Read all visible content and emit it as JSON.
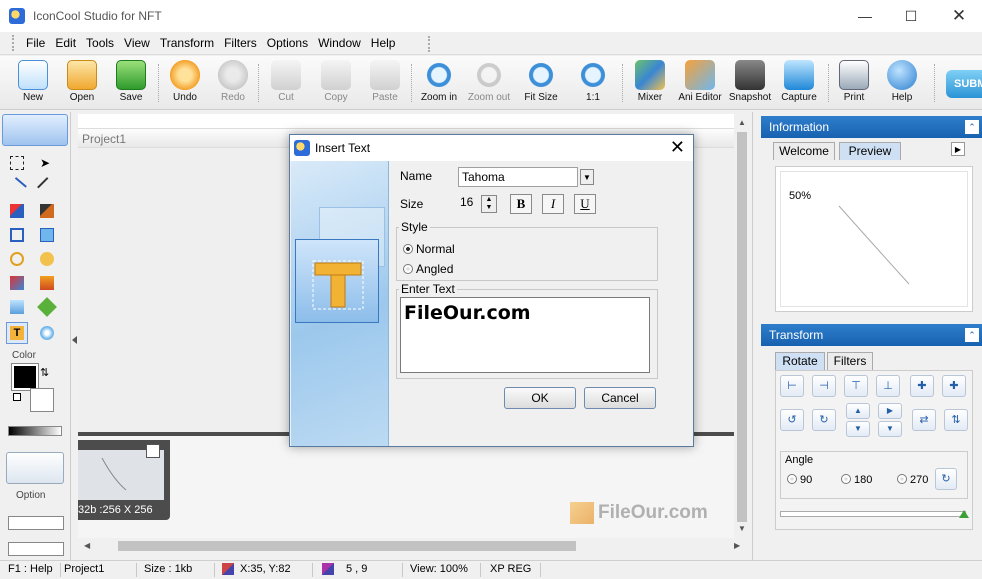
{
  "window": {
    "title": "IconCool Studio for NFT"
  },
  "menu": [
    "File",
    "Edit",
    "Tools",
    "View",
    "Transform",
    "Filters",
    "Options",
    "Window",
    "Help"
  ],
  "toolbar": [
    {
      "label": "New",
      "icon": "new-document-icon",
      "enabled": true
    },
    {
      "label": "Open",
      "icon": "open-folder-icon",
      "enabled": true
    },
    {
      "label": "Save",
      "icon": "save-disk-icon",
      "enabled": true
    },
    {
      "label": "Undo",
      "icon": "undo-arrow-icon",
      "enabled": true
    },
    {
      "label": "Redo",
      "icon": "redo-arrow-icon",
      "enabled": false
    },
    {
      "label": "Cut",
      "icon": "scissors-icon",
      "enabled": false
    },
    {
      "label": "Copy",
      "icon": "copy-icon",
      "enabled": false
    },
    {
      "label": "Paste",
      "icon": "paste-clipboard-icon",
      "enabled": false
    },
    {
      "label": "Zoom in",
      "icon": "zoom-in-icon",
      "enabled": true
    },
    {
      "label": "Zoom out",
      "icon": "zoom-out-icon",
      "enabled": false
    },
    {
      "label": "Fit Size",
      "icon": "fit-size-icon",
      "enabled": true
    },
    {
      "label": "1:1",
      "icon": "actual-size-icon",
      "enabled": true
    },
    {
      "label": "Mixer",
      "icon": "mixer-icon",
      "enabled": true
    },
    {
      "label": "Ani Editor",
      "icon": "ani-editor-icon",
      "enabled": true
    },
    {
      "label": "Snapshot",
      "icon": "camera-icon",
      "enabled": true
    },
    {
      "label": "Capture",
      "icon": "capture-icon",
      "enabled": true
    },
    {
      "label": "Print",
      "icon": "printer-icon",
      "enabled": true
    },
    {
      "label": "Help",
      "icon": "help-question-icon",
      "enabled": true
    }
  ],
  "submit_label": "SUBM",
  "left_panel": {
    "color_label": "Color",
    "option_label": "Option"
  },
  "project": {
    "title": "Project1",
    "thumb_caption": "32b :256 X 256"
  },
  "dialog": {
    "title": "Insert Text",
    "name_label": "Name",
    "font_name": "Tahoma",
    "size_label": "Size",
    "size_value": "16",
    "bold": "B",
    "italic": "I",
    "underline": "U",
    "style_label": "Style",
    "style_normal": "Normal",
    "style_angled": "Angled",
    "enter_text_label": "Enter Text",
    "text_value": "FileOur.com",
    "ok": "OK",
    "cancel": "Cancel"
  },
  "info_panel": {
    "title": "Information",
    "tabs": [
      "Welcome",
      "Preview"
    ],
    "active_tab": "Preview",
    "zoom": "50%"
  },
  "transform_panel": {
    "title": "Transform",
    "tabs": [
      "Rotate",
      "Filters"
    ],
    "active_tab": "Rotate",
    "angle_label": "Angle",
    "angles": [
      "90",
      "180",
      "270"
    ]
  },
  "statusbar": {
    "help": "F1 : Help",
    "project": "Project1",
    "size": "Size : 1kb",
    "coords": "X:35, Y:82",
    "sel": "5 , 9",
    "view": "View: 100%",
    "mode": "XP REG"
  },
  "watermark": "FileOur.com",
  "colors": {
    "accent": "#1762b0",
    "toolbar_bg": "#ececec"
  }
}
